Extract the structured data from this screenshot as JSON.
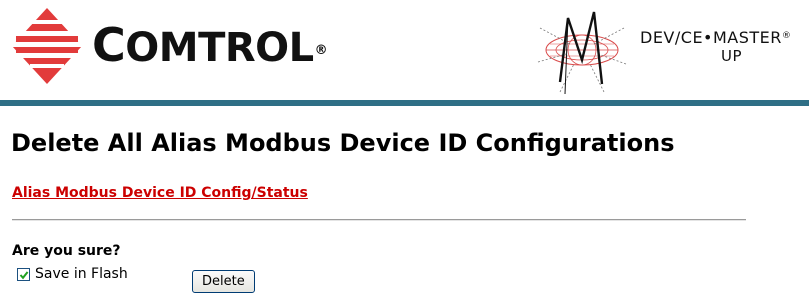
{
  "header": {
    "company_logo": {
      "wordmark_initial": "C",
      "wordmark_rest": "OMTROL",
      "wordmark_mark": "®",
      "brand_color": "#e23b3b"
    },
    "product_logo": {
      "name": "DEV/CE•MASTER",
      "name_mark": "®",
      "subname": "UP"
    },
    "rule_color": "#2f6f86"
  },
  "page": {
    "title": "Delete All Alias Modbus Device ID Configurations",
    "status_link": "Alias Modbus Device ID Config/Status",
    "link_color": "#cc0000",
    "confirm_prompt": "Are you sure?",
    "save_in_flash": {
      "label": "Save in Flash",
      "checked": true
    },
    "delete_button": "Delete"
  }
}
